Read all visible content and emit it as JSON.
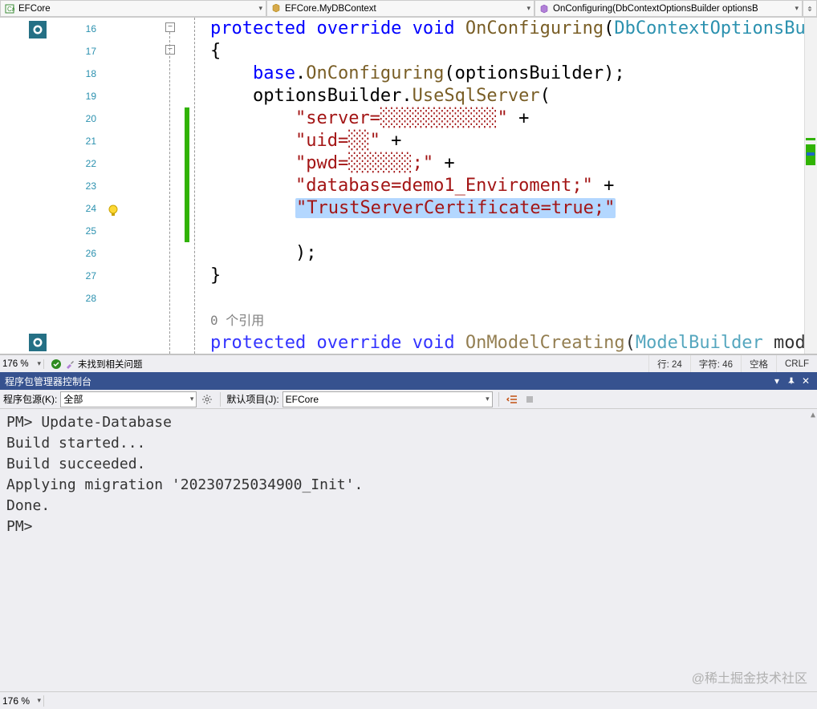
{
  "nav": {
    "project": "EFCore",
    "class": "EFCore.MyDBContext",
    "method": "OnConfiguring(DbContextOptionsBuilder optionsB"
  },
  "code": {
    "startLine": 16,
    "lines": [
      {
        "n": "16",
        "tokens": [
          [
            "kw",
            "protected"
          ],
          [
            "pl",
            " "
          ],
          [
            "kw",
            "override"
          ],
          [
            "pl",
            " "
          ],
          [
            "kw",
            "void"
          ],
          [
            "pl",
            " "
          ],
          [
            "fn",
            "OnConfiguring"
          ],
          [
            "pl",
            "("
          ],
          [
            "typ",
            "DbContextOptionsBuilder"
          ],
          [
            "pl",
            " "
          ]
        ]
      },
      {
        "n": "17",
        "tokens": [
          [
            "pl",
            "{"
          ]
        ]
      },
      {
        "n": "18",
        "tokens": [
          [
            "pl",
            "    "
          ],
          [
            "kw",
            "base"
          ],
          [
            "pl",
            "."
          ],
          [
            "fn",
            "OnConfiguring"
          ],
          [
            "pl",
            "(optionsBuilder);"
          ]
        ]
      },
      {
        "n": "19",
        "tokens": [
          [
            "pl",
            "    optionsBuilder."
          ],
          [
            "fn",
            "UseSqlServer"
          ],
          [
            "pl",
            "("
          ]
        ]
      },
      {
        "n": "20",
        "tokens": [
          [
            "pl",
            "        "
          ],
          [
            "str",
            "\"server=░░░░░░░░░░░\""
          ],
          [
            "pl",
            " +"
          ]
        ]
      },
      {
        "n": "21",
        "tokens": [
          [
            "pl",
            "        "
          ],
          [
            "str",
            "\"uid=░░\""
          ],
          [
            "pl",
            " +"
          ]
        ]
      },
      {
        "n": "22",
        "tokens": [
          [
            "pl",
            "        "
          ],
          [
            "str",
            "\"pwd=░░░░░░;\""
          ],
          [
            "pl",
            " +"
          ]
        ]
      },
      {
        "n": "23",
        "tokens": [
          [
            "pl",
            "        "
          ],
          [
            "str",
            "\"database=demo1_Enviroment;\""
          ],
          [
            "pl",
            " +"
          ]
        ]
      },
      {
        "n": "24",
        "tokens": [
          [
            "pl",
            "        "
          ],
          [
            "strhl",
            "\"TrustServerCertificate=true;\""
          ]
        ]
      },
      {
        "n": "25",
        "tokens": []
      },
      {
        "n": "26",
        "tokens": [
          [
            "pl",
            "        );"
          ]
        ]
      },
      {
        "n": "27",
        "tokens": [
          [
            "pl",
            "}"
          ]
        ]
      },
      {
        "n": "28",
        "tokens": []
      }
    ],
    "references": "0 个引用",
    "partialNext": "protected override void OnModelCreating(ModelBuilder modelBuil"
  },
  "status": {
    "zoom": "176 %",
    "issues": "未找到相关问题",
    "row": "行: 24",
    "col": "字符: 46",
    "ins": "空格",
    "eol": "CRLF",
    "bottomZoom": "176 %"
  },
  "panel": {
    "title": "程序包管理器控制台",
    "srcLabel": "程序包源(K):",
    "srcValue": "全部",
    "projLabel": "默认项目(J):",
    "projValue": "EFCore"
  },
  "console": {
    "lines": [
      "PM> Update-Database",
      "Build started...",
      "Build succeeded.",
      "Applying migration '20230725034900_Init'.",
      "Done.",
      "PM>"
    ]
  },
  "watermark": "@稀土掘金技术社区"
}
